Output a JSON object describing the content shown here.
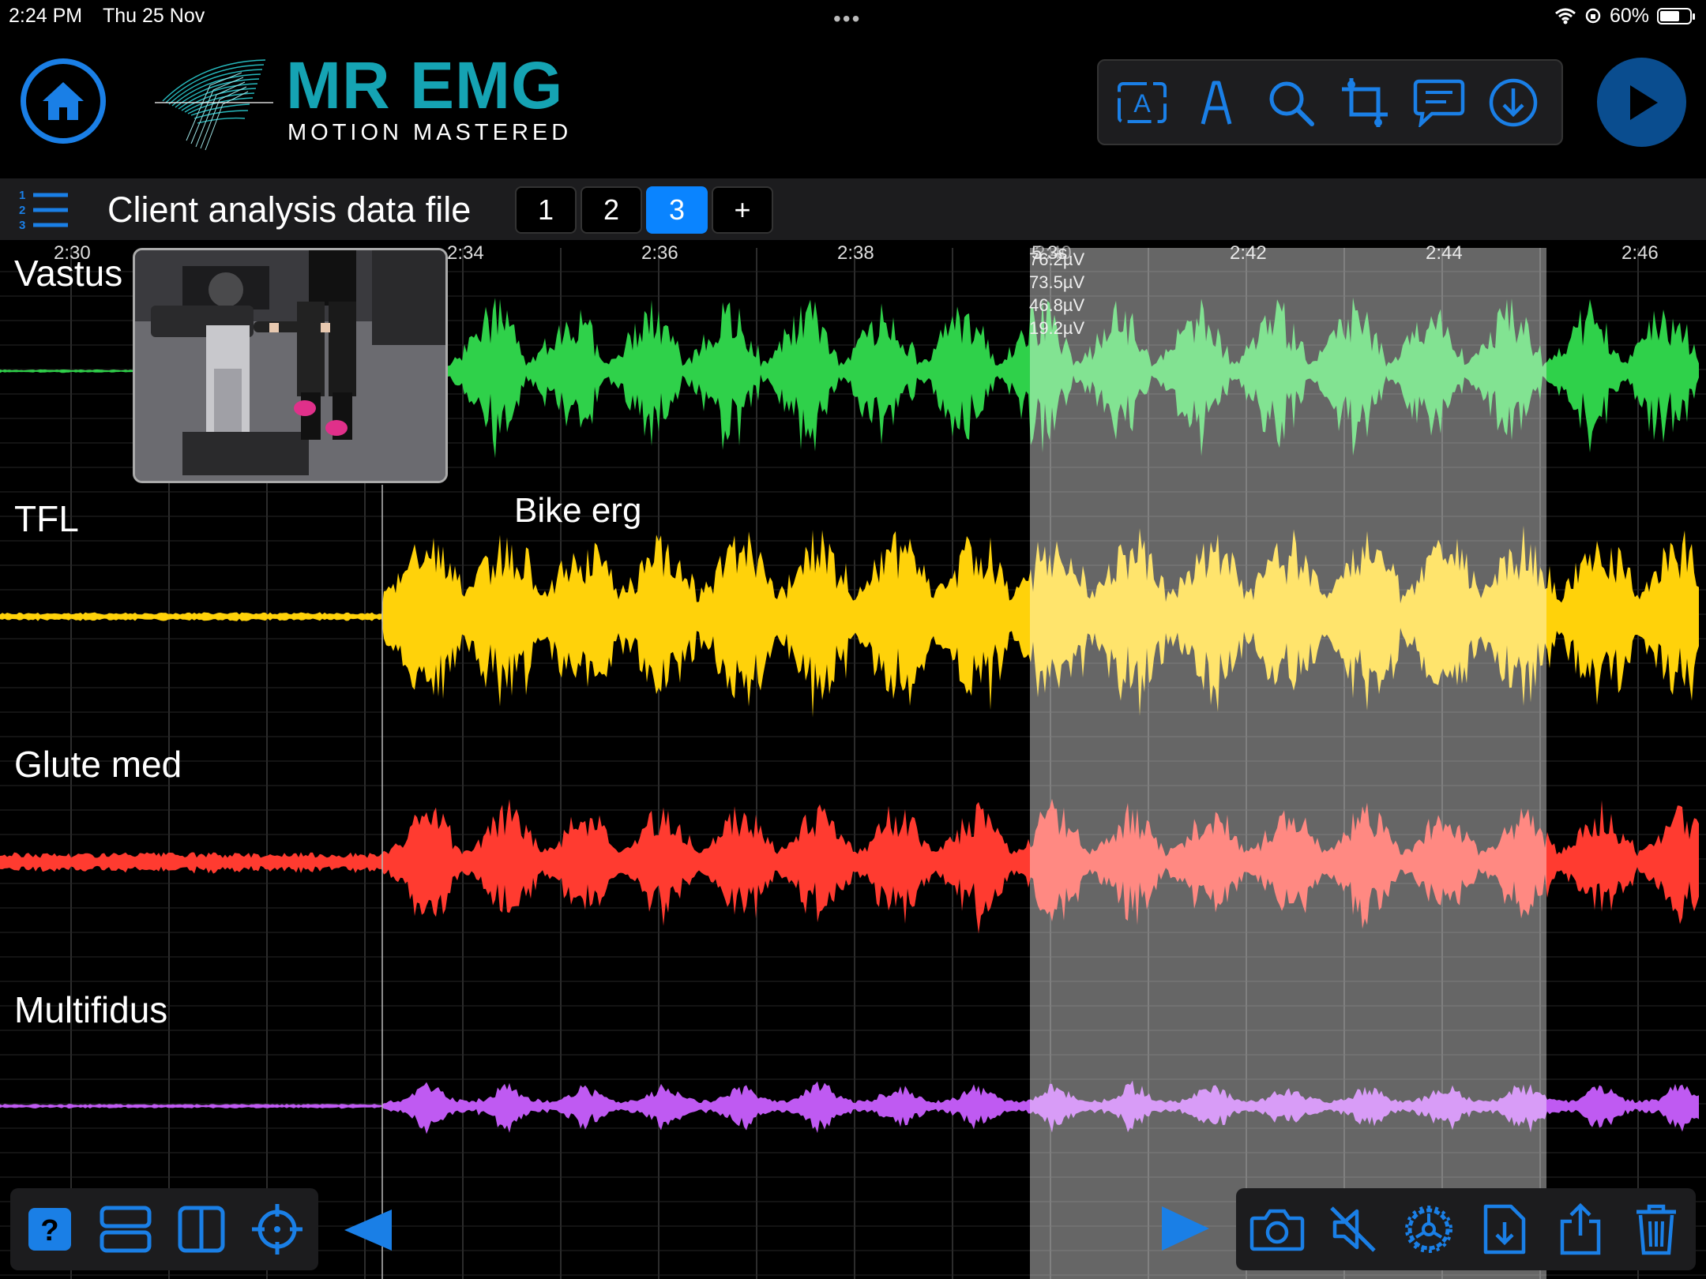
{
  "status_bar": {
    "time": "2:24 PM",
    "date": "Thu 25 Nov",
    "battery": "60%",
    "multitask_dots": "•••"
  },
  "header": {
    "brand_title": "MR EMG",
    "brand_subtitle": "MOTION MASTERED",
    "toolbar": [
      "text-annotation-icon",
      "pen-icon",
      "search-icon",
      "crop-icon",
      "comment-icon",
      "download-icon"
    ],
    "accent_color": "#1a7fe6",
    "brand_color": "#15a3b3"
  },
  "file": {
    "title": "Client analysis data file",
    "pages": [
      "1",
      "2",
      "3",
      "+"
    ],
    "active_page": "3"
  },
  "timeline": {
    "time_labels": [
      "2:30",
      "2:34",
      "2:36",
      "2:38",
      "2:42",
      "2:44",
      "2:46"
    ],
    "selection_duration": "5.3s",
    "selection_faint_label": "2:40"
  },
  "cursor_readout": [
    "76.2µV",
    "73.5µV",
    "46.8µV",
    "19.2µV"
  ],
  "annotation": "Bike erg",
  "channels": [
    {
      "name": "Vastus Lat",
      "color": "#2fd14a"
    },
    {
      "name": "TFL",
      "color": "#ffd20a"
    },
    {
      "name": "Glute med",
      "color": "#ff3b30"
    },
    {
      "name": "Multifidus",
      "color": "#bf5af2"
    }
  ],
  "bottom_toolbar_left": [
    "help-icon",
    "stacked-layout-icon",
    "split-layout-icon",
    "crosshair-icon"
  ],
  "bottom_toolbar_right": [
    "camera-icon",
    "mute-icon",
    "settings-icon",
    "export-file-icon",
    "share-icon",
    "trash-icon"
  ]
}
